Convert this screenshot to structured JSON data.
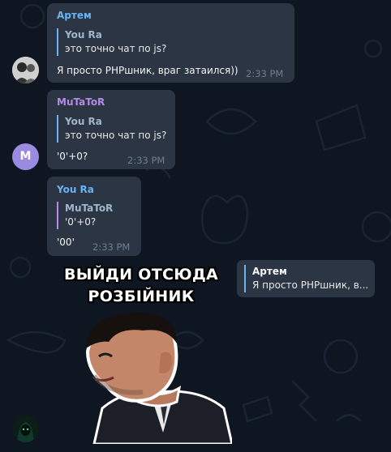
{
  "colors": {
    "background": "#0e1621",
    "bubble": "#2b3543",
    "accent_blue": "#6ab3f3",
    "accent_purple": "#b38be8",
    "timestamp": "#6d7f8f",
    "avatar_m": "#9b8be0"
  },
  "messages": [
    {
      "sender": "Артем",
      "reply_to_name": "You Ra",
      "reply_to_text": "это точно чат по js?",
      "text": "Я просто PHPшник, враг затаился))",
      "time": "2:33 PM"
    },
    {
      "sender": "MuTaToR",
      "reply_to_name": "You Ra",
      "reply_to_text": "это точно чат по js?",
      "text": "'0'+0?",
      "time": "2:33 PM",
      "avatar_letter": "M"
    },
    {
      "sender": "You Ra",
      "reply_to_name": "MuTaToR",
      "reply_to_text": "'0'+0?",
      "text": "'00'",
      "time": "2:33 PM"
    }
  ],
  "sticker": {
    "line1": "ВЫЙДИ ОТСЮДА",
    "line2": "РОЗБІЙНИК",
    "reply_to_name": "Артем",
    "reply_to_text": "Я просто PHPшник, в..."
  },
  "icons": {
    "avatar_artem": "photo-avatar",
    "avatar_last": "hacker-avatar",
    "wallpaper": "doodle-pattern"
  }
}
